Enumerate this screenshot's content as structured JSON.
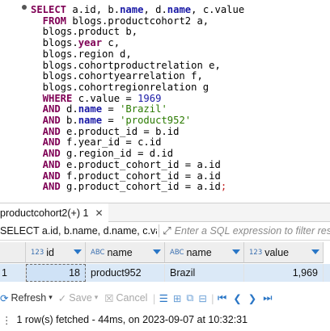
{
  "editor": {
    "lines": [
      [
        {
          "t": "SELECT",
          "c": "kw"
        },
        {
          "t": " a.id, b.",
          "c": ""
        },
        {
          "t": "name",
          "c": "fld"
        },
        {
          "t": ", d.",
          "c": ""
        },
        {
          "t": "name",
          "c": "fld"
        },
        {
          "t": ", c.value",
          "c": ""
        }
      ],
      [
        {
          "t": "  FROM",
          "c": "kw"
        },
        {
          "t": " blogs.productcohort2 a,",
          "c": ""
        }
      ],
      [
        {
          "t": "  blogs.product b,",
          "c": ""
        }
      ],
      [
        {
          "t": "  blogs.",
          "c": ""
        },
        {
          "t": "year",
          "c": "kw"
        },
        {
          "t": " c,",
          "c": ""
        }
      ],
      [
        {
          "t": "  blogs.region d,",
          "c": ""
        }
      ],
      [
        {
          "t": "  blogs.cohortproductrelation e,",
          "c": ""
        }
      ],
      [
        {
          "t": "  blogs.cohortyearrelation f,",
          "c": ""
        }
      ],
      [
        {
          "t": "  blogs.cohortregionrelation g",
          "c": ""
        }
      ],
      [
        {
          "t": "  WHERE",
          "c": "kw"
        },
        {
          "t": " c.value = ",
          "c": ""
        },
        {
          "t": "1969",
          "c": "num"
        }
      ],
      [
        {
          "t": "  AND",
          "c": "kw"
        },
        {
          "t": " d.",
          "c": ""
        },
        {
          "t": "name",
          "c": "fld"
        },
        {
          "t": " = ",
          "c": ""
        },
        {
          "t": "'Brazil'",
          "c": "str"
        }
      ],
      [
        {
          "t": "  AND",
          "c": "kw"
        },
        {
          "t": " b.",
          "c": ""
        },
        {
          "t": "name",
          "c": "fld"
        },
        {
          "t": " = ",
          "c": ""
        },
        {
          "t": "'product952'",
          "c": "str"
        }
      ],
      [
        {
          "t": "  AND",
          "c": "kw"
        },
        {
          "t": " e.product_id = b.id",
          "c": ""
        }
      ],
      [
        {
          "t": "  AND",
          "c": "kw"
        },
        {
          "t": " f.year_id = c.id",
          "c": ""
        }
      ],
      [
        {
          "t": "  AND",
          "c": "kw"
        },
        {
          "t": " g.region_id = d.id",
          "c": ""
        }
      ],
      [
        {
          "t": "  AND",
          "c": "kw"
        },
        {
          "t": " e.product_cohort_id = a.id",
          "c": ""
        }
      ],
      [
        {
          "t": "  AND",
          "c": "kw"
        },
        {
          "t": " f.product_cohort_id = a.id",
          "c": ""
        }
      ],
      [
        {
          "t": "  AND",
          "c": "kw"
        },
        {
          "t": " g.product_cohort_id = a.id",
          "c": ""
        },
        {
          "t": ";",
          "c": "semi"
        }
      ]
    ]
  },
  "results_tab": {
    "label": "productcohort2(+) 1",
    "close_glyph": "✕"
  },
  "filter": {
    "query_text": "SELECT a.id, b.name, d.name, c.value",
    "placeholder": "Enter a SQL expression to filter results"
  },
  "grid": {
    "columns": [
      {
        "type": "123",
        "label": "id"
      },
      {
        "type": "ABC",
        "label": "name"
      },
      {
        "type": "ABC",
        "label": "name"
      },
      {
        "type": "123",
        "label": "value"
      }
    ],
    "rows": [
      {
        "num": "1",
        "id": "18",
        "product": "product952",
        "region": "Brazil",
        "value": "1,969"
      }
    ]
  },
  "toolbar": {
    "refresh": "Refresh",
    "save": "Save",
    "cancel": "Cancel"
  },
  "status": {
    "text": "1 row(s) fetched - 44ms, on 2023-09-07 at 10:32:31"
  },
  "colors": {
    "keyword": "#7f0055",
    "string": "#2a7a00",
    "selection": "#dbe9f7",
    "sort_arrow": "#2a76c6"
  }
}
